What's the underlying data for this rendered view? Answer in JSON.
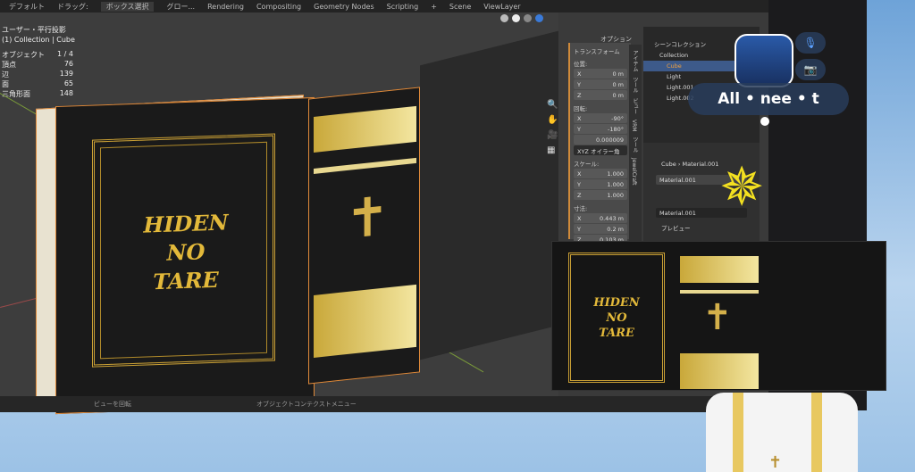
{
  "topbar": {
    "mode": "デフォルト",
    "drag_label": "ドラッグ:",
    "drag_value": "ボックス選択",
    "global": "グロー...",
    "workspaces": [
      "Rendering",
      "Compositing",
      "Geometry Nodes",
      "Scripting"
    ],
    "add": "+",
    "scene": "Scene",
    "view_layer": "ViewLayer"
  },
  "viewport": {
    "view_name": "ユーザー・平行投影",
    "collection": "(1) Collection | Cube",
    "options": "オプション",
    "stats": [
      {
        "label": "オブジェクト",
        "value": "1 / 4"
      },
      {
        "label": "頂点",
        "value": "76"
      },
      {
        "label": "辺",
        "value": "139"
      },
      {
        "label": "面",
        "value": "65"
      },
      {
        "label": "三角形面",
        "value": "148"
      }
    ]
  },
  "book": {
    "title_lines": [
      "HIDEN",
      "NO",
      "TARE"
    ]
  },
  "npanel": {
    "header": "トランスフォーム",
    "location_label": "位置:",
    "location": [
      {
        "axis": "X",
        "value": "0 m"
      },
      {
        "axis": "Y",
        "value": "0 m"
      },
      {
        "axis": "Z",
        "value": "0 m"
      }
    ],
    "rotation_label": "回転:",
    "rotation": [
      {
        "axis": "X",
        "value": "-90°"
      },
      {
        "axis": "Y",
        "value": "-180°"
      },
      {
        "axis": "",
        "value": "0.000009"
      }
    ],
    "rotation_mode": "XYZ オイラー角",
    "scale_label": "スケール:",
    "scale": [
      {
        "axis": "X",
        "value": "1.000"
      },
      {
        "axis": "Y",
        "value": "1.000"
      },
      {
        "axis": "Z",
        "value": "1.000"
      }
    ],
    "dimensions_label": "寸法:",
    "dimensions": [
      {
        "axis": "X",
        "value": "0.443 m"
      },
      {
        "axis": "Y",
        "value": "0.2 m"
      },
      {
        "axis": "Z",
        "value": "0.103 m"
      }
    ],
    "tabs": [
      "アイテム",
      "ツール",
      "ビュー",
      "VRM",
      "ツール",
      "JewelCraft"
    ]
  },
  "outliner": {
    "scene_collection": "シーンコレクション",
    "collection": "Collection",
    "items": [
      "Cube",
      "Light",
      "Light.001",
      "Light.002"
    ]
  },
  "properties": {
    "breadcrumb_object": "Cube",
    "breadcrumb_material": "Material.001",
    "slot": "Material.001",
    "material": "Material.001",
    "preview": "プレビュー"
  },
  "footer": {
    "rotate_view": "ビューを回転",
    "context_menu": "オブジェクトコンテクストメニュー"
  },
  "vr": {
    "player_name": "All • nee • t"
  }
}
